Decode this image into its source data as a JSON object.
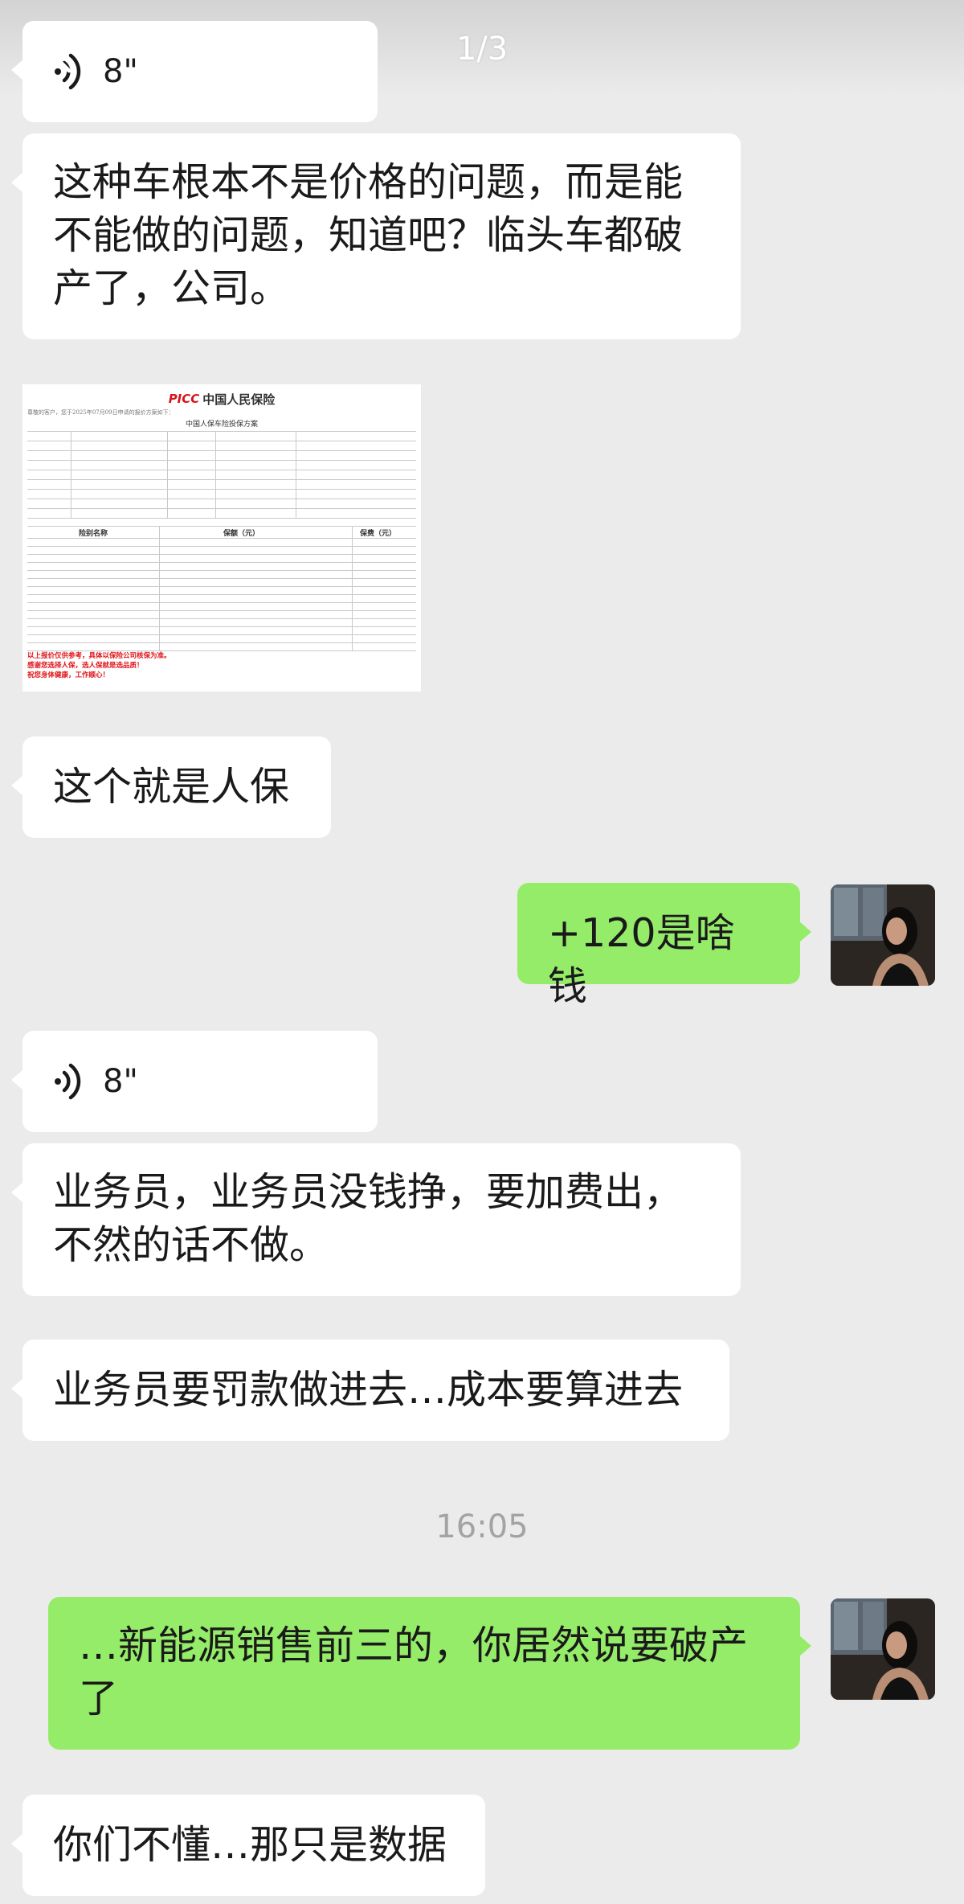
{
  "viewer": {
    "counter": "1/3",
    "close_icon": "close-icon"
  },
  "messages": {
    "m1_voice_duration": "8\"",
    "m2_text_line1": "这种车根本不是价格的问题，而是能",
    "m2_text_line2": "不能做的问题，知道吧？临头车都破",
    "m2_text_line3": "产了，公司。",
    "m3_image": {
      "logo": "PICC",
      "company": "中国人民保险",
      "greeting": "尊敬的客户，您于2025年07月09日申请的报价方案如下：",
      "doc_title": "中国人保车险投保方案",
      "col_insurance_name": "险别名称",
      "col_coverage": "保额（元）",
      "col_premium": "保费（元）",
      "red_line1": "以上报价仅供参考，具体以保险公司核保为准。",
      "red_line2": "感谢您选择人保，选人保就是选品质！",
      "red_line3": "祝您身体健康，工作顺心！"
    },
    "m4_text": "这个就是人保",
    "m5_text": "+120是啥钱",
    "m6_voice_duration": "8\"",
    "m7_text_line1": "业务员，业务员没钱挣，要加费出，",
    "m7_text_line2": "不然的话不做。",
    "m8_text": "业务员要罚款做进去…成本要算进去",
    "timestamp": "16:05",
    "m9_text_line1": "…新能源销售前三的，你居然说要破产",
    "m9_text_line2": "了",
    "m10_text": "你们不懂…那只是数据"
  },
  "colors": {
    "background": "#ebebeb",
    "bubble_left": "#ffffff",
    "bubble_right": "#95ec69",
    "timestamp": "#a3a3a3"
  }
}
